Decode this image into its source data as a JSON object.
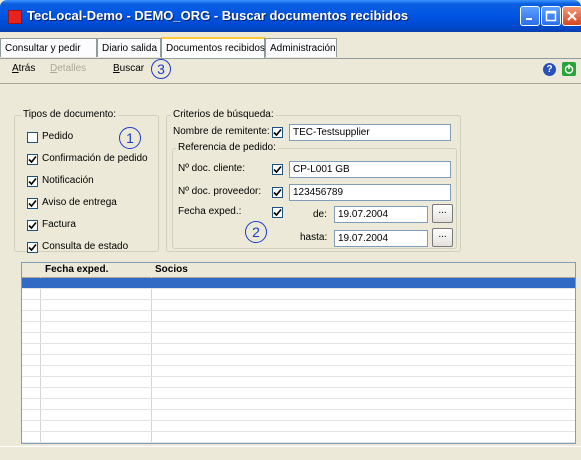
{
  "window": {
    "title": "TecLocal-Demo - DEMO_ORG - Buscar documentos recibidos",
    "controls": [
      "minimize",
      "maximize",
      "close"
    ]
  },
  "tabs": [
    {
      "label": "Consultar y pedir",
      "active": false
    },
    {
      "label": "Diario salida",
      "active": false
    },
    {
      "label": "Documentos recibidos",
      "active": true
    },
    {
      "label": "Administración",
      "active": false
    }
  ],
  "toolbar": {
    "back": {
      "label": "Atrás",
      "accel": "A",
      "rest": "trás",
      "enabled": true
    },
    "details": {
      "label": "Detalles",
      "accel": "D",
      "rest": "etalles",
      "enabled": false
    },
    "search": {
      "label": "Buscar",
      "accel": "B",
      "rest": "uscar",
      "enabled": true
    },
    "annotation": "3",
    "help_icon": "?",
    "exit_icon": "power-icon"
  },
  "doc_types": {
    "title": "Tipos de documento:",
    "annotation": "1",
    "items": [
      {
        "label": "Pedido",
        "checked": false
      },
      {
        "label": "Confirmación de pedido",
        "checked": true
      },
      {
        "label": "Notificación",
        "checked": true
      },
      {
        "label": "Aviso de entrega",
        "checked": true
      },
      {
        "label": "Factura",
        "checked": true
      },
      {
        "label": "Consulta de estado",
        "checked": true
      }
    ]
  },
  "criteria": {
    "title": "Criterios de búsqueda:",
    "sender_label": "Nombre de remitente:",
    "sender_checked": true,
    "sender_value": "TEC-Testsupplier",
    "order_ref": {
      "title": "Referencia de pedido:",
      "customer_label": "Nº doc. cliente:",
      "customer_checked": true,
      "customer_value": "CP-L001 GB",
      "supplier_label": "Nº doc. proveedor:",
      "supplier_checked": true,
      "supplier_value": "123456789",
      "date_label": "Fecha exped.:",
      "date_checked": true,
      "from_label": "de:",
      "from_value": "19.07.2004",
      "to_label": "hasta:",
      "to_value": "19.07.2004",
      "browse_label": "...",
      "annotation": "2"
    }
  },
  "results": {
    "columns": [
      "Fecha exped.",
      "Socios"
    ],
    "selected_row": 0
  },
  "colors": {
    "title_bar": "#0054e3",
    "annotation": "#1c3cc8",
    "selection": "#316ac5"
  }
}
